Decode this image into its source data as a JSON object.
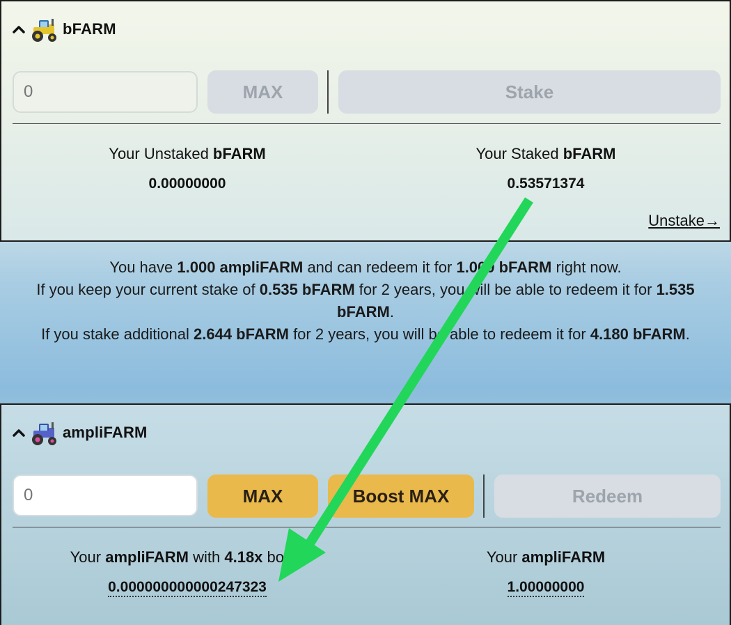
{
  "top_panel": {
    "token": "bFARM",
    "input": {
      "value": "",
      "placeholder": "0"
    },
    "max_label": "MAX",
    "stake_label": "Stake",
    "unstaked": {
      "prefix": "Your Unstaked ",
      "token": "bFARM",
      "value": "0.00000000"
    },
    "staked": {
      "prefix": "Your Staked ",
      "token": "bFARM",
      "value": "0.53571374"
    },
    "unstake_link": "Unstake→"
  },
  "info": {
    "line1": {
      "a": "You have ",
      "b": "1.000 ampliFARM",
      "c": " and can redeem it for ",
      "d": "1.000 bFARM",
      "e": " right now."
    },
    "line2": {
      "a": "If you keep your current stake of ",
      "b": "0.535 bFARM",
      "c": " for 2 years, you will be able to redeem it for ",
      "d": "1.535 bFARM",
      "e": "."
    },
    "line3": {
      "a": "If you stake additional ",
      "b": "2.644 bFARM",
      "c": " for 2 years, you will be able to redeem it for ",
      "d": "4.180 bFARM",
      "e": "."
    }
  },
  "bottom_panel": {
    "token": "ampliFARM",
    "input": {
      "value": "",
      "placeholder": "0"
    },
    "max_label": "MAX",
    "boost_max_label": "Boost MAX",
    "redeem_label": "Redeem",
    "boosted": {
      "prefix": "Your ",
      "token": "ampliFARM",
      "mid": " with ",
      "boost": "4.18x",
      "suffix": " boost",
      "value": "0.000000000000247323"
    },
    "plain": {
      "prefix": "Your ",
      "token": "ampliFARM",
      "value": "1.00000000"
    }
  },
  "colors": {
    "annotation_arrow": "#22d65a",
    "gold_button": "#e9b94c",
    "disabled_button": "#d7dde3"
  },
  "icons": {
    "collapse": "chevron-up-icon",
    "bfarm": "yellow-tractor-icon",
    "amplifarm": "blue-tractor-icon"
  }
}
